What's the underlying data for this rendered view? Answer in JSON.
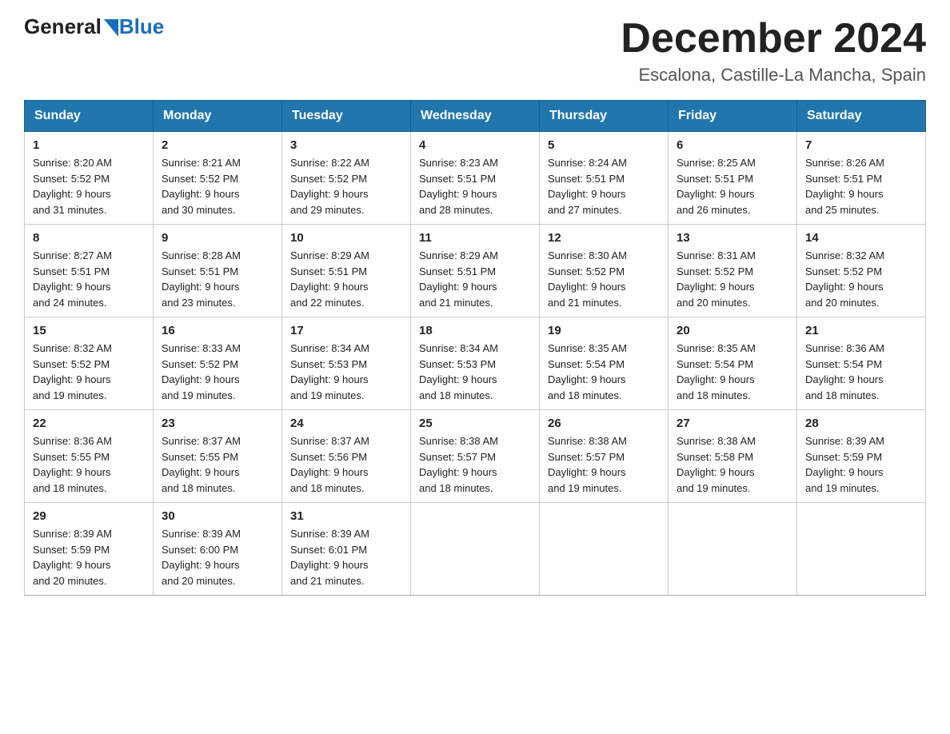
{
  "header": {
    "logo_general": "General",
    "logo_blue": "Blue",
    "main_title": "December 2024",
    "subtitle": "Escalona, Castille-La Mancha, Spain"
  },
  "calendar": {
    "days_of_week": [
      "Sunday",
      "Monday",
      "Tuesday",
      "Wednesday",
      "Thursday",
      "Friday",
      "Saturday"
    ],
    "weeks": [
      [
        {
          "date": "1",
          "sunrise": "8:20 AM",
          "sunset": "5:52 PM",
          "daylight": "9 hours and 31 minutes."
        },
        {
          "date": "2",
          "sunrise": "8:21 AM",
          "sunset": "5:52 PM",
          "daylight": "9 hours and 30 minutes."
        },
        {
          "date": "3",
          "sunrise": "8:22 AM",
          "sunset": "5:52 PM",
          "daylight": "9 hours and 29 minutes."
        },
        {
          "date": "4",
          "sunrise": "8:23 AM",
          "sunset": "5:51 PM",
          "daylight": "9 hours and 28 minutes."
        },
        {
          "date": "5",
          "sunrise": "8:24 AM",
          "sunset": "5:51 PM",
          "daylight": "9 hours and 27 minutes."
        },
        {
          "date": "6",
          "sunrise": "8:25 AM",
          "sunset": "5:51 PM",
          "daylight": "9 hours and 26 minutes."
        },
        {
          "date": "7",
          "sunrise": "8:26 AM",
          "sunset": "5:51 PM",
          "daylight": "9 hours and 25 minutes."
        }
      ],
      [
        {
          "date": "8",
          "sunrise": "8:27 AM",
          "sunset": "5:51 PM",
          "daylight": "9 hours and 24 minutes."
        },
        {
          "date": "9",
          "sunrise": "8:28 AM",
          "sunset": "5:51 PM",
          "daylight": "9 hours and 23 minutes."
        },
        {
          "date": "10",
          "sunrise": "8:29 AM",
          "sunset": "5:51 PM",
          "daylight": "9 hours and 22 minutes."
        },
        {
          "date": "11",
          "sunrise": "8:29 AM",
          "sunset": "5:51 PM",
          "daylight": "9 hours and 21 minutes."
        },
        {
          "date": "12",
          "sunrise": "8:30 AM",
          "sunset": "5:52 PM",
          "daylight": "9 hours and 21 minutes."
        },
        {
          "date": "13",
          "sunrise": "8:31 AM",
          "sunset": "5:52 PM",
          "daylight": "9 hours and 20 minutes."
        },
        {
          "date": "14",
          "sunrise": "8:32 AM",
          "sunset": "5:52 PM",
          "daylight": "9 hours and 20 minutes."
        }
      ],
      [
        {
          "date": "15",
          "sunrise": "8:32 AM",
          "sunset": "5:52 PM",
          "daylight": "9 hours and 19 minutes."
        },
        {
          "date": "16",
          "sunrise": "8:33 AM",
          "sunset": "5:52 PM",
          "daylight": "9 hours and 19 minutes."
        },
        {
          "date": "17",
          "sunrise": "8:34 AM",
          "sunset": "5:53 PM",
          "daylight": "9 hours and 19 minutes."
        },
        {
          "date": "18",
          "sunrise": "8:34 AM",
          "sunset": "5:53 PM",
          "daylight": "9 hours and 18 minutes."
        },
        {
          "date": "19",
          "sunrise": "8:35 AM",
          "sunset": "5:54 PM",
          "daylight": "9 hours and 18 minutes."
        },
        {
          "date": "20",
          "sunrise": "8:35 AM",
          "sunset": "5:54 PM",
          "daylight": "9 hours and 18 minutes."
        },
        {
          "date": "21",
          "sunrise": "8:36 AM",
          "sunset": "5:54 PM",
          "daylight": "9 hours and 18 minutes."
        }
      ],
      [
        {
          "date": "22",
          "sunrise": "8:36 AM",
          "sunset": "5:55 PM",
          "daylight": "9 hours and 18 minutes."
        },
        {
          "date": "23",
          "sunrise": "8:37 AM",
          "sunset": "5:55 PM",
          "daylight": "9 hours and 18 minutes."
        },
        {
          "date": "24",
          "sunrise": "8:37 AM",
          "sunset": "5:56 PM",
          "daylight": "9 hours and 18 minutes."
        },
        {
          "date": "25",
          "sunrise": "8:38 AM",
          "sunset": "5:57 PM",
          "daylight": "9 hours and 18 minutes."
        },
        {
          "date": "26",
          "sunrise": "8:38 AM",
          "sunset": "5:57 PM",
          "daylight": "9 hours and 19 minutes."
        },
        {
          "date": "27",
          "sunrise": "8:38 AM",
          "sunset": "5:58 PM",
          "daylight": "9 hours and 19 minutes."
        },
        {
          "date": "28",
          "sunrise": "8:39 AM",
          "sunset": "5:59 PM",
          "daylight": "9 hours and 19 minutes."
        }
      ],
      [
        {
          "date": "29",
          "sunrise": "8:39 AM",
          "sunset": "5:59 PM",
          "daylight": "9 hours and 20 minutes."
        },
        {
          "date": "30",
          "sunrise": "8:39 AM",
          "sunset": "6:00 PM",
          "daylight": "9 hours and 20 minutes."
        },
        {
          "date": "31",
          "sunrise": "8:39 AM",
          "sunset": "6:01 PM",
          "daylight": "9 hours and 21 minutes."
        },
        null,
        null,
        null,
        null
      ]
    ]
  }
}
